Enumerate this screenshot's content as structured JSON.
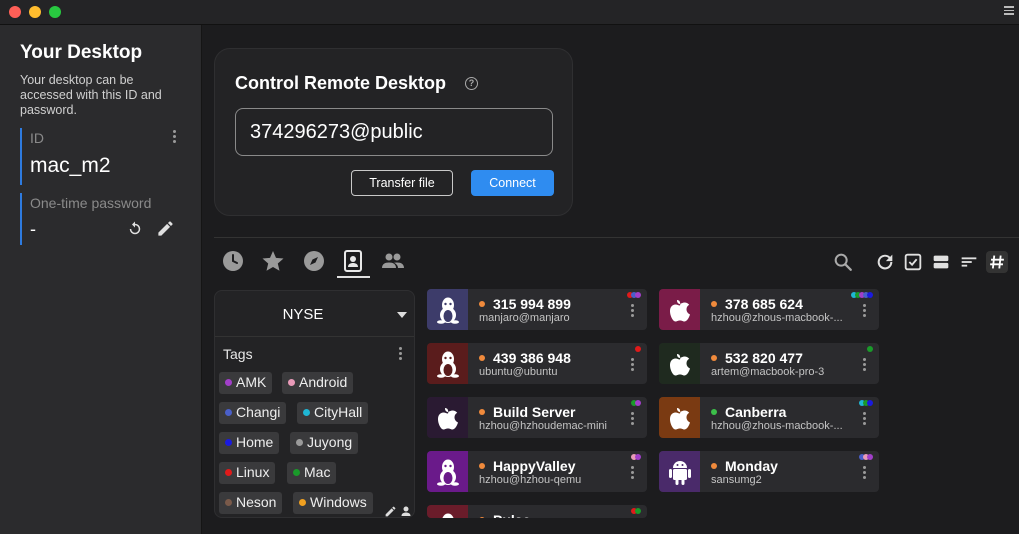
{
  "sidebar": {
    "title": "Your Desktop",
    "description": "Your desktop can be accessed with this ID and password.",
    "id_label": "ID",
    "id_value": "mac_m2",
    "password_label": "One-time password",
    "password_value": "-"
  },
  "control": {
    "title": "Control Remote Desktop",
    "input_value": "374296273@public",
    "transfer_label": "Transfer file",
    "connect_label": "Connect"
  },
  "tabs": [
    {
      "icon": "clock-icon"
    },
    {
      "icon": "star-icon"
    },
    {
      "icon": "compass-icon"
    },
    {
      "icon": "address-book-icon",
      "active": true
    },
    {
      "icon": "group-icon"
    }
  ],
  "address_book": {
    "name": "NYSE",
    "tags_label": "Tags",
    "tags": [
      {
        "name": "AMK",
        "color": "#a13fc9"
      },
      {
        "name": "Android",
        "color": "#e89ab8"
      },
      {
        "name": "Changi",
        "color": "#4a5fc9"
      },
      {
        "name": "CityHall",
        "color": "#1fb6d4"
      },
      {
        "name": "Home",
        "color": "#1a1ae0"
      },
      {
        "name": "Juyong",
        "color": "#9a9a9a"
      },
      {
        "name": "Linux",
        "color": "#e01a1a"
      },
      {
        "name": "Mac",
        "color": "#1a9a2a"
      },
      {
        "name": "Neson",
        "color": "#7a5a4a"
      },
      {
        "name": "Windows",
        "color": "#f0a020"
      }
    ]
  },
  "peers": [
    {
      "name": "315 994 899",
      "sub": "manjaro@manjaro",
      "os": "linux",
      "thumb": "#3d3c6a",
      "status": "#f08a3c",
      "tags": [
        "#e01a1a",
        "#4a5fc9",
        "#a13fc9"
      ]
    },
    {
      "name": "378 685 624",
      "sub": "hzhou@zhous-macbook-...",
      "os": "mac",
      "thumb": "#7a1c48",
      "status": "#f08a3c",
      "tags": [
        "#1fb6d4",
        "#1a9a2a",
        "#a13fc9",
        "#4a5fc9",
        "#1a1ae0"
      ]
    },
    {
      "name": "439 386 948",
      "sub": "ubuntu@ubuntu",
      "os": "linux",
      "thumb": "#5a1c1c",
      "status": "#f08a3c",
      "tags": [
        "#e01a1a"
      ]
    },
    {
      "name": "532 820 477",
      "sub": "artem@macbook-pro-3",
      "os": "mac",
      "thumb": "#1f2a1f",
      "status": "#f08a3c",
      "tags": [
        "#1a9a2a"
      ]
    },
    {
      "name": "Build Server",
      "sub": "hzhou@hzhoudemac-mini",
      "os": "mac",
      "thumb": "#2a1a32",
      "status": "#f08a3c",
      "tags": [
        "#1a9a2a",
        "#a13fc9"
      ]
    },
    {
      "name": "Canberra",
      "sub": "hzhou@zhous-macbook-...",
      "os": "mac",
      "thumb": "#7a3a12",
      "status": "#3cc04a",
      "tags": [
        "#1fb6d4",
        "#1a9a2a",
        "#1a1ae0"
      ]
    },
    {
      "name": "HappyValley",
      "sub": "hzhou@hzhou-qemu",
      "os": "linux",
      "thumb": "#6a1a8a",
      "status": "#f08a3c",
      "tags": [
        "#e89ab8",
        "#a13fc9"
      ]
    },
    {
      "name": "Monday",
      "sub": "sansumg2",
      "os": "android",
      "thumb": "#4a2a6a",
      "status": "#f08a3c",
      "tags": [
        "#4a5fc9",
        "#e89ab8",
        "#a13fc9"
      ]
    },
    {
      "name": "Pulse",
      "sub": "",
      "os": "linux",
      "thumb": "#6a1c2a",
      "status": "#f08a3c",
      "tags": [
        "#e01a1a",
        "#1a9a2a"
      ]
    }
  ]
}
